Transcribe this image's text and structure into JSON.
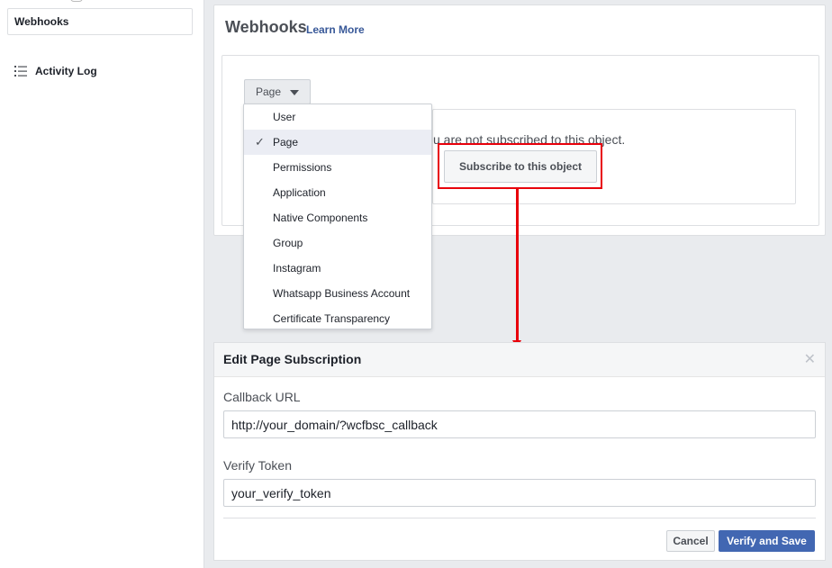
{
  "sidebar": {
    "active_item": "Webhooks",
    "items": [
      {
        "label": "Activity Log",
        "icon": "list-icon"
      }
    ]
  },
  "webhooks": {
    "title": "Webhooks",
    "learn_more": "Learn More",
    "object_select": {
      "value": "Page"
    },
    "dropdown": {
      "options": [
        "User",
        "Page",
        "Permissions",
        "Application",
        "Native Components",
        "Group",
        "Instagram",
        "Whatsapp Business Account",
        "Certificate Transparency"
      ],
      "selected": "Page"
    },
    "subscription": {
      "message": "u are not subscribed to this object.",
      "button": "Subscribe to this object"
    }
  },
  "annotation": {
    "color": "#e8000b"
  },
  "edit_panel": {
    "title": "Edit Page Subscription",
    "callback_label": "Callback URL",
    "callback_value": "http://your_domain/?wcfbsc_callback",
    "verify_label": "Verify Token",
    "verify_value": "your_verify_token",
    "cancel": "Cancel",
    "save": "Verify and Save"
  },
  "colors": {
    "primary": "#4267b2",
    "link": "#385898",
    "background": "#e9ebee"
  }
}
